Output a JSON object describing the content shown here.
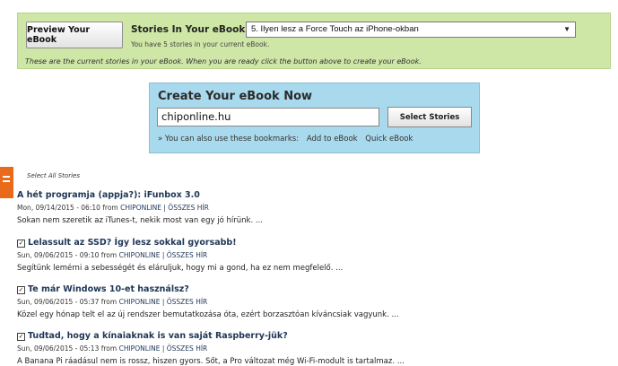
{
  "top_panel": {
    "preview_button": "Preview Your eBook",
    "stories_label": "Stories In Your eBook:",
    "selected_story": "5. Ilyen lesz a Force Touch az iPhone-okban",
    "stories_count": "You have 5 stories in your current eBook.",
    "note": "These are the current stories in your eBook. When you are ready click the button above to create your eBook."
  },
  "create_panel": {
    "title": "Create Your eBook Now",
    "input_value": "chiponline.hu",
    "select_button": "Select Stories",
    "bookmarks_prefix": "» You can also use these bookmarks:",
    "bookmark_add": "Add to eBook",
    "bookmark_quick": "Quick eBook"
  },
  "select_all": "Select All Stories",
  "stories": [
    {
      "title": "A hét programja (appja?): iFunbox 3.0",
      "date": "Mon, 09/14/2015 - 06:10 from",
      "source": "CHIPONLINE | ÖSSZES HÍR",
      "desc": "Sokan nem szeretik az iTunes-t, nekik most van egy jó hírünk. ..."
    },
    {
      "title": "Lelassult az SSD? Így lesz sokkal gyorsabb!",
      "date": "Sun, 09/06/2015 - 09:10 from",
      "source": "CHIPONLINE | ÖSSZES HÍR",
      "desc": "Segítünk lemérni a sebességét és eláruljuk, hogy mi a gond, ha ez nem megfelelő. ..."
    },
    {
      "title": "Te már Windows 10-et használsz?",
      "date": "Sun, 09/06/2015 - 05:37 from",
      "source": "CHIPONLINE | ÖSSZES HÍR",
      "desc": "Közel egy hónap telt el az új rendszer bemutatkozása óta, ezért borzasztóan kíváncsiak vagyunk. ..."
    },
    {
      "title": "Tudtad, hogy a kínaiaknak is van saját Raspberry-jük?",
      "date": "Sun, 09/06/2015 - 05:13 from",
      "source": "CHIPONLINE | ÖSSZES HÍR",
      "desc": "A Banana Pi ráadásul nem is rossz, hiszen gyors. Sőt, a Pro változat még Wi-Fi-modult is tartalmaz. ..."
    }
  ],
  "colors": {
    "top_panel_bg": "#cfe7a6",
    "create_panel_bg": "#a9d9ec",
    "accent": "#e86a1a",
    "title_link": "#1e3656"
  }
}
